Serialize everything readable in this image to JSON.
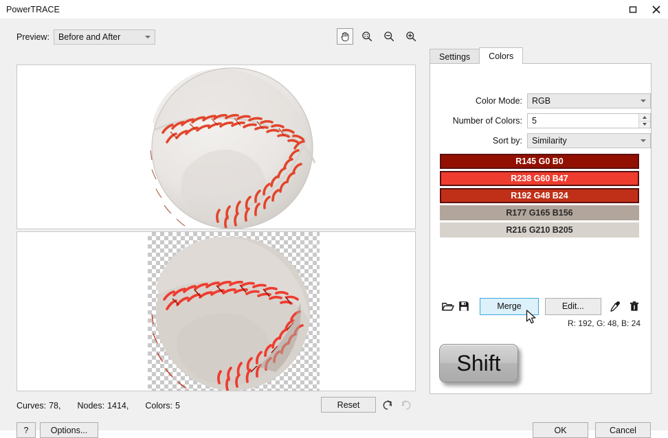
{
  "window": {
    "title": "PowerTRACE",
    "controls": [
      {
        "name": "maximize-button",
        "icon": "maximize-icon"
      },
      {
        "name": "close-button",
        "icon": "close-icon"
      }
    ]
  },
  "preview": {
    "label": "Preview:",
    "mode": "Before and After"
  },
  "zoom_tools": [
    {
      "name": "pan-tool",
      "icon": "hand-icon",
      "active": true
    },
    {
      "name": "zoom-fit-tool",
      "icon": "zoom-fit-icon",
      "active": false
    },
    {
      "name": "zoom-out-tool",
      "icon": "zoom-out-icon",
      "active": false
    },
    {
      "name": "zoom-in-tool",
      "icon": "zoom-in-icon",
      "active": false
    }
  ],
  "status": {
    "curves_label": "Curves:",
    "curves_value": "78,",
    "nodes_label": "Nodes:",
    "nodes_value": "1414,",
    "colors_label": "Colors:",
    "colors_value": "5",
    "reset_label": "Reset",
    "undo_icon": "undo-icon",
    "redo_icon": "redo-icon"
  },
  "footer": {
    "help_label": "?",
    "options_label": "Options...",
    "ok_label": "OK",
    "cancel_label": "Cancel"
  },
  "tabs": [
    {
      "label": "Settings",
      "active": false
    },
    {
      "label": "Colors",
      "active": true
    }
  ],
  "colors_panel": {
    "color_mode_label": "Color Mode:",
    "color_mode_value": "RGB",
    "number_of_colors_label": "Number of Colors:",
    "number_of_colors_value": "5",
    "sort_by_label": "Sort by:",
    "sort_by_value": "Similarity",
    "swatches": [
      {
        "label": "R145 G0 B0",
        "hex": "#911000",
        "text": "#ffffff",
        "selected": true
      },
      {
        "label": "R238 G60 B47",
        "hex": "#ee3c2f",
        "text": "#ffffff",
        "selected": true
      },
      {
        "label": "R192 G48 B24",
        "hex": "#c03018",
        "text": "#ffffff",
        "selected": true
      },
      {
        "label": "R177 G165 B156",
        "hex": "#b1a59c",
        "text": "#2a2a2a",
        "selected": false
      },
      {
        "label": "R216 G210 B205",
        "hex": "#d8d2cd",
        "text": "#2a2a2a",
        "selected": false
      }
    ],
    "actions": {
      "open_icon": "folder-open-icon",
      "save_icon": "save-floppy-icon",
      "merge_label": "Merge",
      "edit_label": "Edit...",
      "eyedropper_icon": "eyedropper-icon",
      "delete_icon": "trash-icon"
    },
    "rgb_readout": "R: 192, G: 48, B: 24"
  },
  "overlay": {
    "keycap_label": "Shift"
  },
  "accent": {
    "highlight_border": "#3aa8d8",
    "highlight_fill": "#ddf1fb",
    "panel_bg": "#f0f0f0"
  }
}
